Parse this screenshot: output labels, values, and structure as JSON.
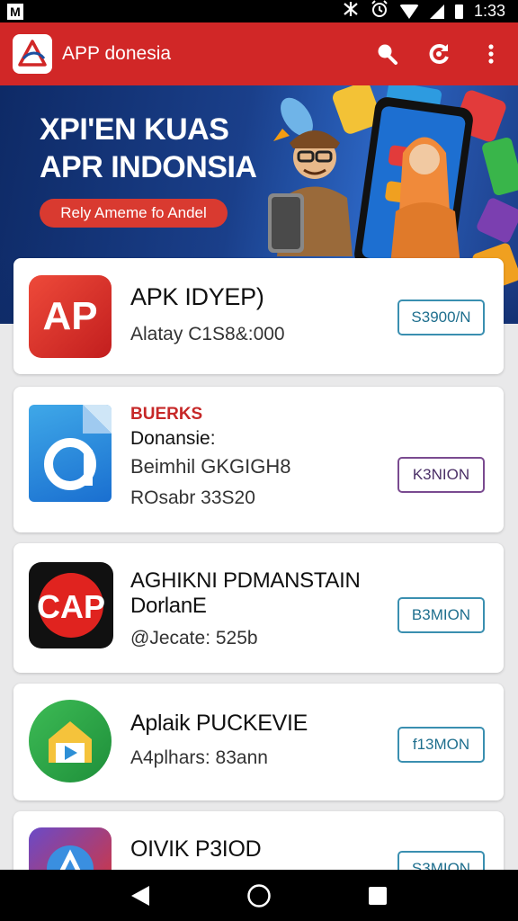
{
  "status_bar": {
    "app_icon_letter": "M",
    "time": "1:33",
    "icons": [
      "notification-icon",
      "alarm-icon",
      "wifi-icon",
      "signal-icon",
      "battery-icon"
    ]
  },
  "app_bar": {
    "title": "APP donesia",
    "actions": [
      "search-icon",
      "refresh-icon",
      "more-vert-icon"
    ],
    "color": "#d12727"
  },
  "banner": {
    "title_line1": "XPI'EN KUAS",
    "title_line2": "APR INDONSIA",
    "cta_label": "Rely Ameme fo Andel"
  },
  "apps": [
    {
      "icon": "ap-red-icon",
      "title": "APK IDYEP)",
      "subtitle": "Alatay C1S8&:000",
      "button_label": "S3900/N"
    },
    {
      "icon": "document-a-icon",
      "tag": "BUERKS",
      "title": "Donansie:",
      "subtitle": "Beimhil GKGIGH8",
      "meta": "ROsabr 33S20",
      "button_label": "K3NION"
    },
    {
      "icon": "cap-logo-icon",
      "title_line1": "AGHIKNI PDMANSTAIN",
      "title_line2": "DorlanE",
      "subtitle": "@Jecate: 525b",
      "button_label": "B3MION"
    },
    {
      "icon": "play-house-icon",
      "title": "Aplaik PUCKEVIE",
      "subtitle": "A4plhars: 83ann",
      "button_label": "f13MON"
    },
    {
      "icon": "compass-icon",
      "title": "OIVIK P3IOD",
      "button_label": "S3MION"
    }
  ],
  "nav_bar": {
    "buttons": [
      "back-icon",
      "home-icon",
      "recents-icon"
    ]
  }
}
